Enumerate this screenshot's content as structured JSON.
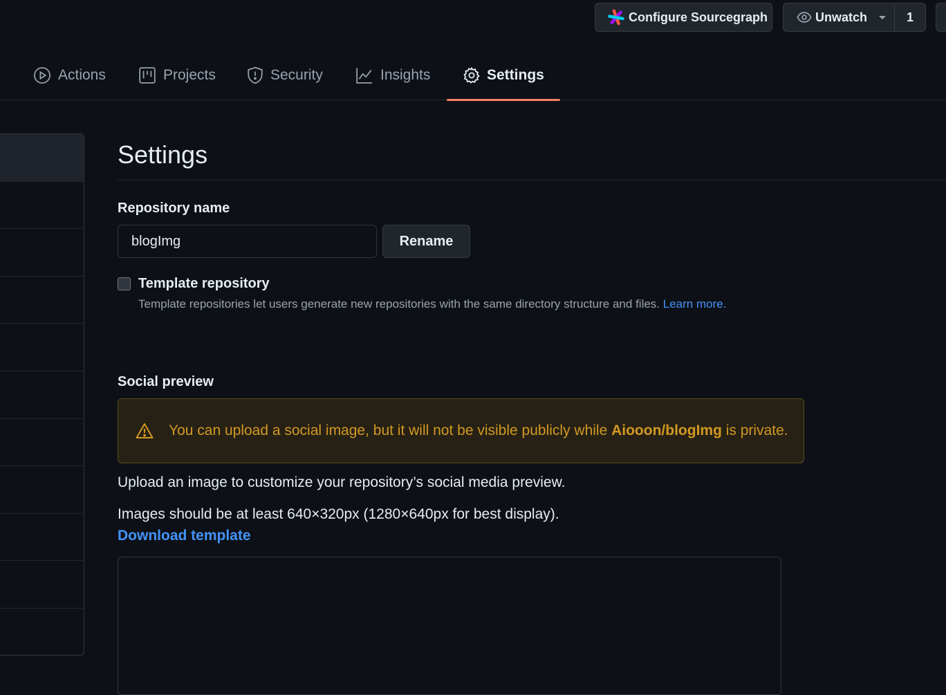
{
  "header": {
    "sourcegraph_label": "Configure Sourcegraph",
    "watch_label": "Unwatch",
    "watch_count": "1"
  },
  "tabs": [
    {
      "label": "Actions",
      "icon": "play-icon"
    },
    {
      "label": "Projects",
      "icon": "project-board-icon"
    },
    {
      "label": "Security",
      "icon": "shield-icon"
    },
    {
      "label": "Insights",
      "icon": "graph-icon"
    },
    {
      "label": "Settings",
      "icon": "gear-icon",
      "active": true
    }
  ],
  "main": {
    "title": "Settings",
    "repo_name_label": "Repository name",
    "repo_name_value": "blogImg",
    "rename_label": "Rename",
    "template_label": "Template repository",
    "template_checked": false,
    "template_note": "Template repositories let users generate new repositories with the same directory structure and files.",
    "learn_more": "Learn more.",
    "social_label": "Social preview",
    "warning_pre": "You can upload a social image, but it will not be visible publicly while",
    "warning_repo": "Aiooon/blogImg",
    "warning_post": "is private.",
    "upload_text": "Upload an image to customize your repository’s social media preview.",
    "size_text": "Images should be at least 640×320px (1280×640px for best display).",
    "download_template": "Download template"
  },
  "colors": {
    "background": "#0d1117",
    "accent_underline": "#f78166",
    "link": "#4493f8",
    "warning_text": "#d29922"
  }
}
